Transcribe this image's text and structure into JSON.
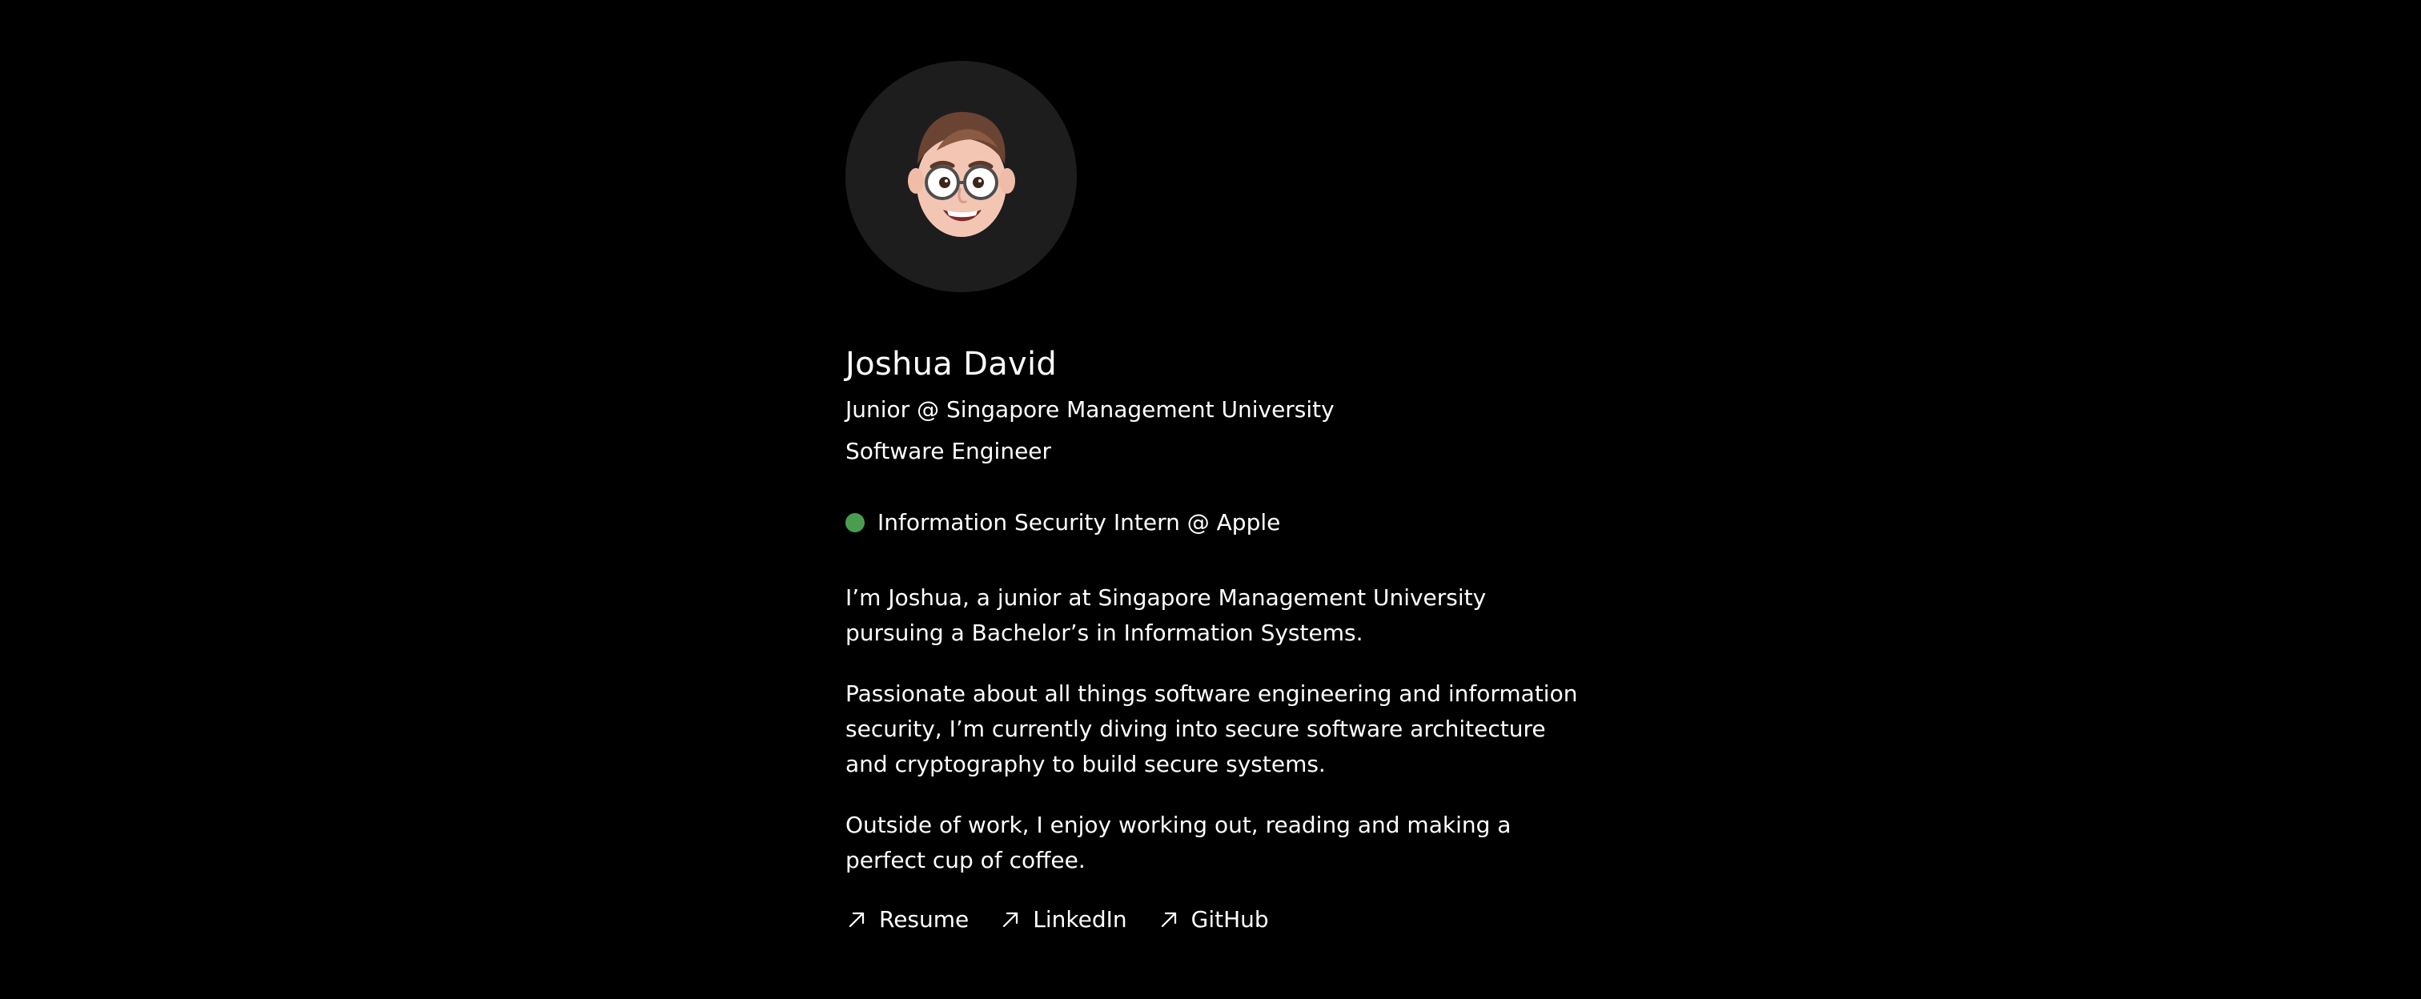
{
  "profile": {
    "name": "Joshua David",
    "subtitle_1": "Junior @ Singapore Management University",
    "subtitle_2": "Software Engineer",
    "avatar_icon": "memoji-avatar-icon",
    "status": {
      "text": "Information Security Intern @ Apple",
      "dot_color": "#4a9d4f"
    }
  },
  "bio": [
    "I’m Joshua, a junior at Singapore Management University pursuing a Bachelor’s in Information Systems.",
    "Passionate about all things software engineering and information security, I’m currently diving into secure software architecture and cryptography to build secure systems.",
    "Outside of work, I enjoy working out, reading and making a perfect cup of coffee."
  ],
  "links": [
    {
      "label": "Resume",
      "icon": "arrow-up-right-icon"
    },
    {
      "label": "LinkedIn",
      "icon": "arrow-up-right-icon"
    },
    {
      "label": "GitHub",
      "icon": "arrow-up-right-icon"
    }
  ],
  "colors": {
    "background": "#000000",
    "avatar_background": "#1e1d1e",
    "text": "#ffffff",
    "status": "#4a9d4f"
  }
}
